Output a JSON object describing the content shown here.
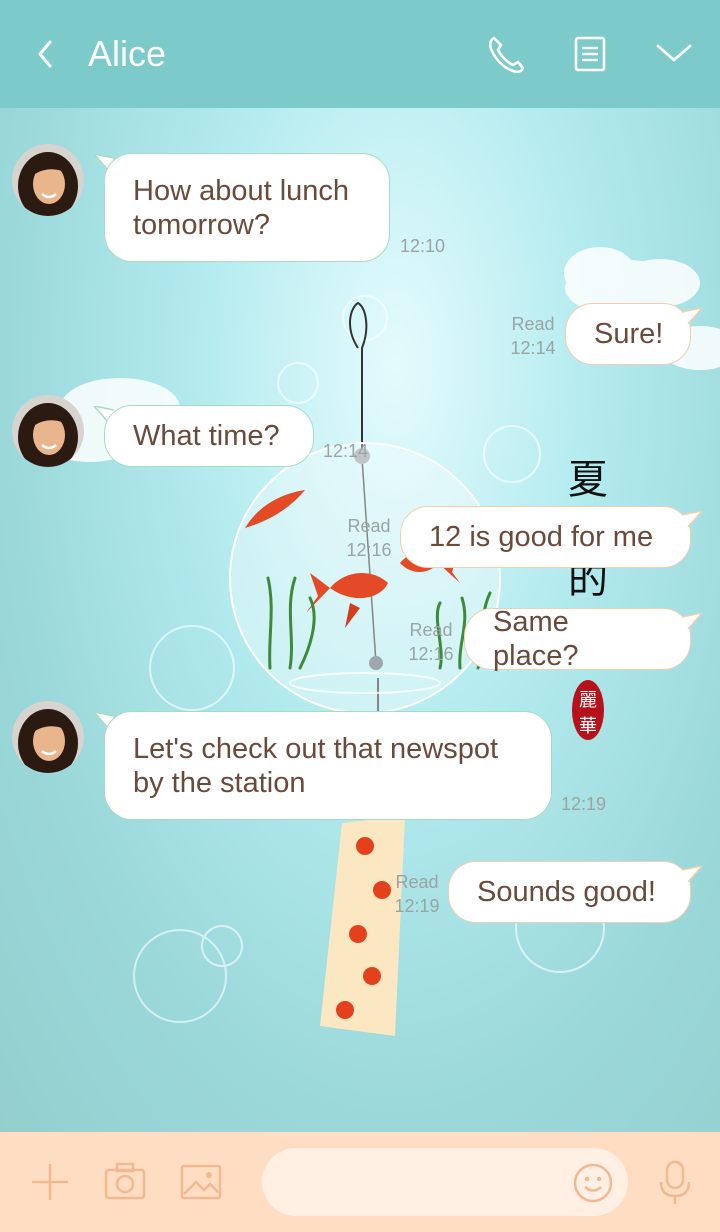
{
  "header": {
    "title": "Alice",
    "back_icon": "chevron-left-icon",
    "call_icon": "phone-icon",
    "notes_icon": "document-icon",
    "menu_icon": "chevron-down-icon",
    "background": "#7ccac9"
  },
  "decoration": {
    "vertical_text": [
      "夏",
      "的"
    ],
    "seal_text": [
      "麗",
      "華"
    ]
  },
  "messages": [
    {
      "direction": "incoming",
      "text_lines": [
        "How about lunch",
        "tomorrow?"
      ],
      "time": "12:10"
    },
    {
      "direction": "outgoing",
      "text_lines": [
        "Sure!"
      ],
      "read": "Read",
      "time": "12:14"
    },
    {
      "direction": "incoming",
      "text_lines": [
        "What time?"
      ],
      "time": "12:14"
    },
    {
      "direction": "outgoing",
      "text_lines": [
        "12 is good for me"
      ],
      "read": "Read",
      "time": "12:16"
    },
    {
      "direction": "outgoing",
      "text_lines": [
        "Same place?"
      ],
      "read": "Read",
      "time": "12:16"
    },
    {
      "direction": "incoming",
      "text_lines": [
        "Let's check out that newspot",
        "by the station"
      ],
      "time": "12:19"
    },
    {
      "direction": "outgoing",
      "text_lines": [
        "Sounds good!"
      ],
      "read": "Read",
      "time": "12:19"
    }
  ],
  "footer": {
    "add_icon": "plus-icon",
    "camera_icon": "camera-icon",
    "image_icon": "image-icon",
    "emoji_icon": "smiley-icon",
    "mic_icon": "microphone-icon",
    "input_value": "",
    "input_placeholder": "",
    "background": "#ffddc2"
  },
  "colors": {
    "incoming_border": "#a6ddbf",
    "outgoing_border": "#f1cfae",
    "text": "#6a4a3a"
  }
}
